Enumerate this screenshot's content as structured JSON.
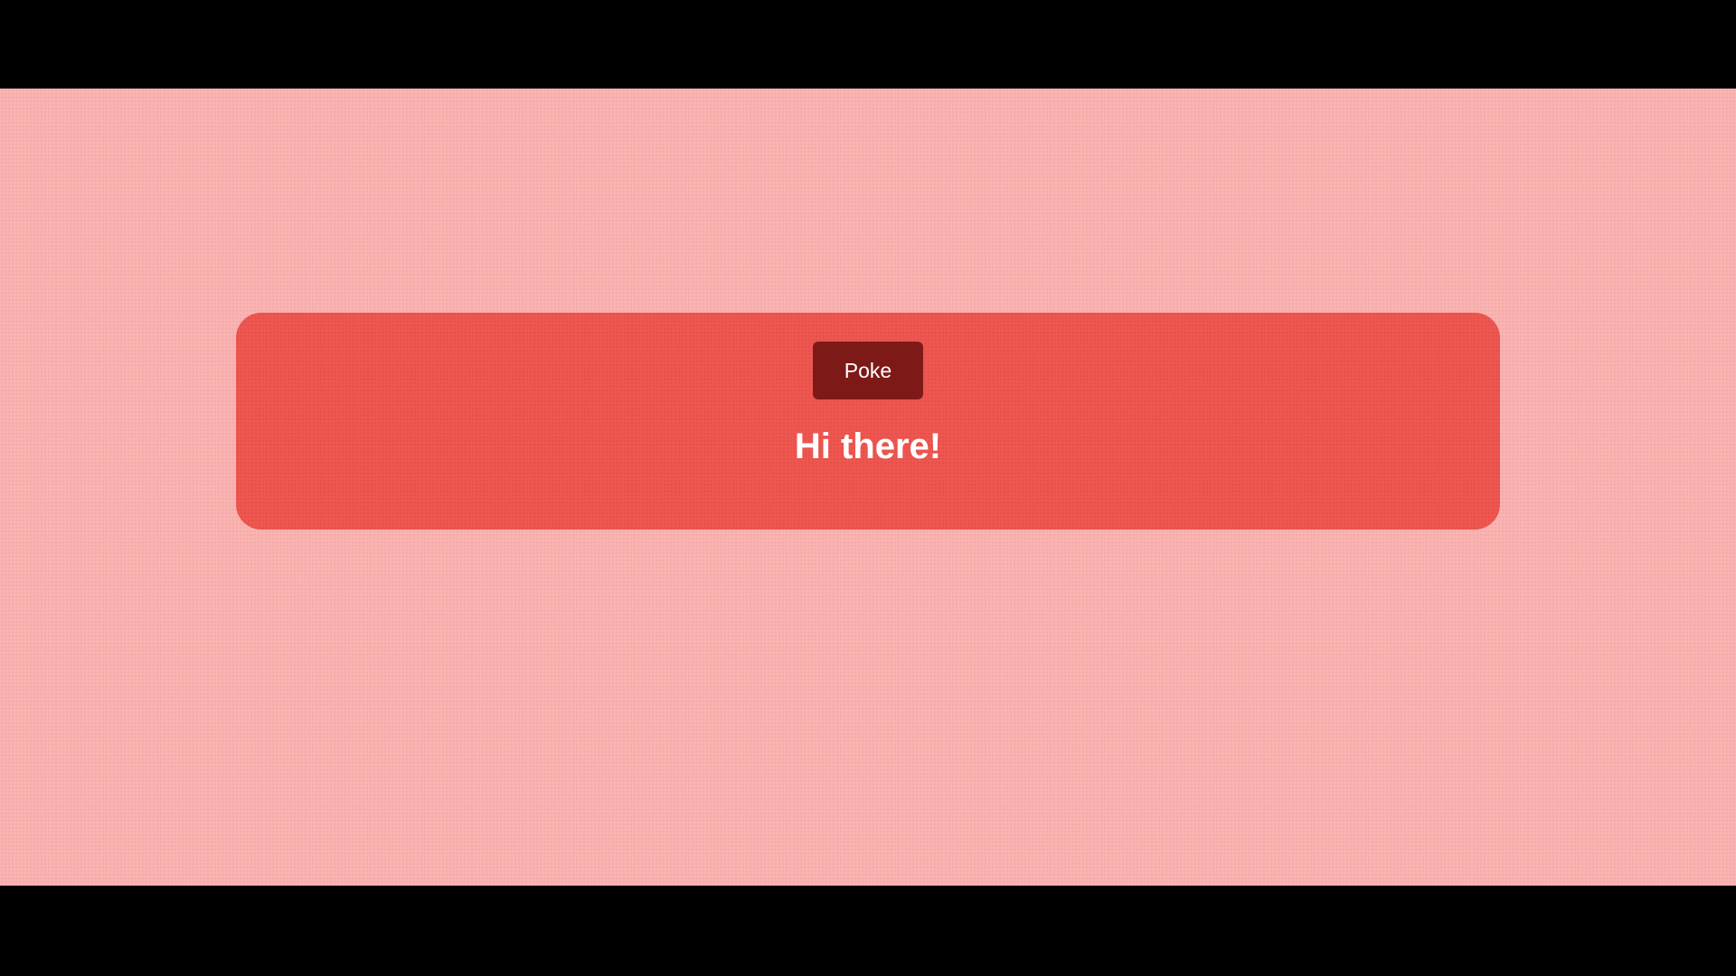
{
  "card": {
    "button_label": "Poke",
    "greeting": "Hi there!"
  },
  "colors": {
    "page_background": "#f9b4b2",
    "card_background": "#ee5650",
    "button_background": "#7d1a18",
    "text": "#ffffff",
    "letterbox": "#000000"
  }
}
